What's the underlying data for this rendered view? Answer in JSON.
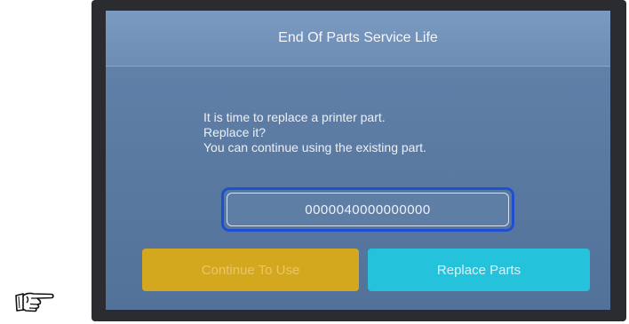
{
  "dialog": {
    "title": "End Of Parts Service Life",
    "message_lines": [
      "It is time to replace a printer part.",
      "Replace it?",
      "You can continue using the existing part."
    ],
    "code": "0000040000000000"
  },
  "buttons": {
    "continue_label": "Continue To Use",
    "replace_label": "Replace Parts"
  },
  "colors": {
    "screen_bg": "#5a7aa2",
    "title_bar": "#7090b8",
    "code_focus_border": "#1f4fd1",
    "continue_button": "#d4a81e",
    "replace_button": "#25c2dc"
  },
  "icons": {
    "pointer": "pointing-hand-icon"
  }
}
